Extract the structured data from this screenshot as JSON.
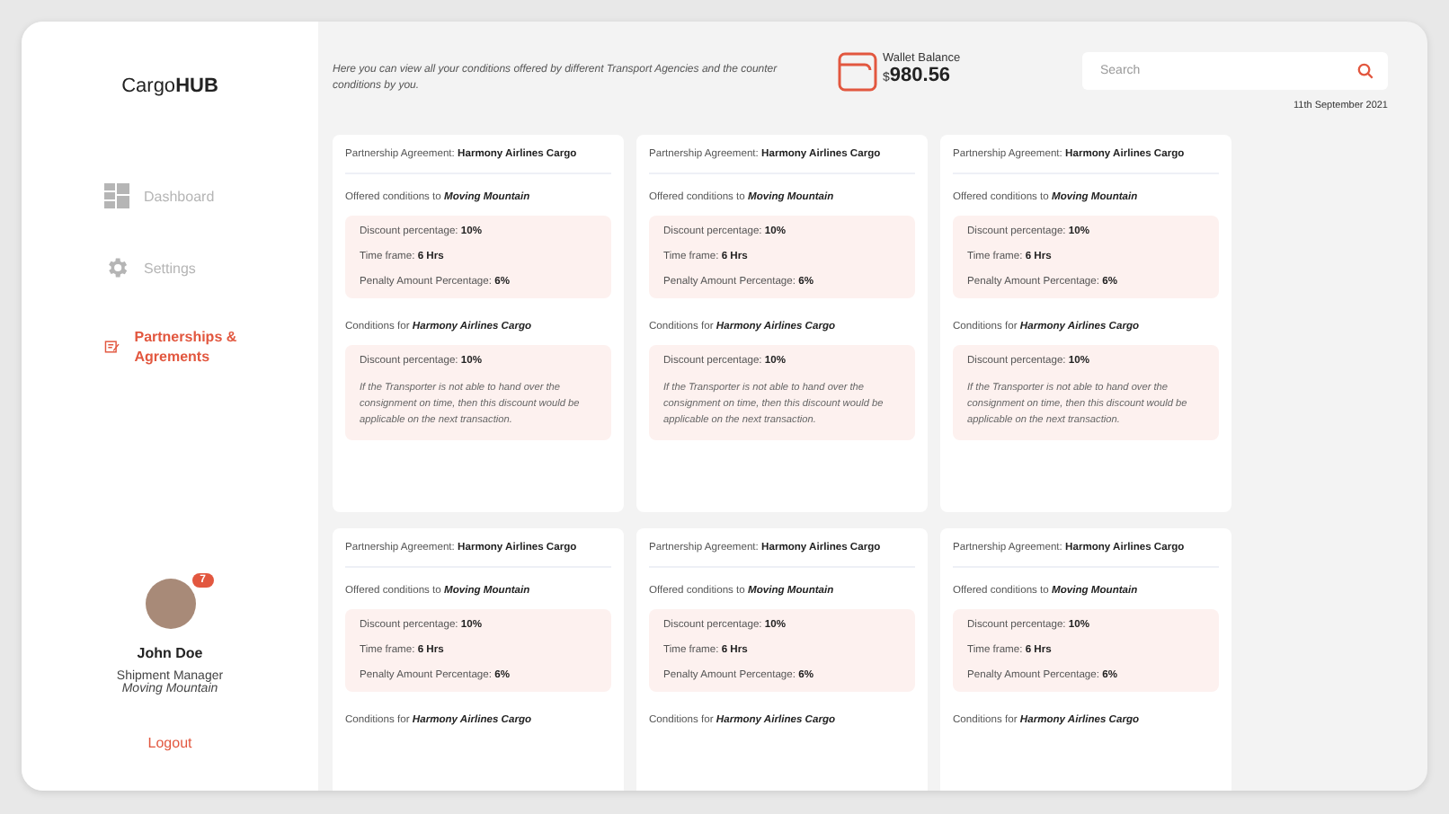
{
  "logo": {
    "light": "Cargo",
    "bold": "HUB"
  },
  "nav": [
    {
      "label": "Dashboard",
      "kind": "dashboard",
      "selected": false
    },
    {
      "label": "Settings",
      "kind": "settings",
      "selected": false
    },
    {
      "label": "Partnerships & Agrements",
      "kind": "partnerships",
      "selected": true
    }
  ],
  "user": {
    "name": "John Doe",
    "role": "Shipment Manager",
    "company": "Moving Mountain",
    "notifications": "7"
  },
  "logout": "Logout",
  "intro": "Here you can view all your conditions offered by different Transport Agencies and the counter conditions by you.",
  "wallet": {
    "label": "Wallet Balance",
    "currency": "$",
    "amount": "980.56"
  },
  "search": {
    "placeholder": "Search"
  },
  "date": "11th September 2021",
  "cards": [
    {
      "agreement_label": "Partnership Agreement:",
      "partner": "Harmony Airlines Cargo",
      "offered_label": "Offered conditions to",
      "offered_to": "Moving Mountain",
      "offered": [
        {
          "label": "Discount percentage:",
          "value": "10%"
        },
        {
          "label": "Time frame:",
          "value": "6 Hrs"
        },
        {
          "label": "Penalty Amount Percentage:",
          "value": "6%"
        }
      ],
      "counter_label": "Conditions for",
      "counter_party": "Harmony Airlines Cargo",
      "counter": [
        {
          "label": "Discount percentage:",
          "value": "10%"
        }
      ],
      "note": "If the Transporter is not able to hand over the consignment on time, then this discount would be applicable on the next transaction."
    },
    {
      "agreement_label": "Partnership Agreement:",
      "partner": "Harmony Airlines Cargo",
      "offered_label": "Offered conditions to",
      "offered_to": "Moving Mountain",
      "offered": [
        {
          "label": "Discount percentage:",
          "value": "10%"
        },
        {
          "label": "Time frame:",
          "value": "6 Hrs"
        },
        {
          "label": "Penalty Amount Percentage:",
          "value": "6%"
        }
      ],
      "counter_label": "Conditions for",
      "counter_party": "Harmony Airlines Cargo",
      "counter": [
        {
          "label": "Discount percentage:",
          "value": "10%"
        }
      ],
      "note": "If the Transporter is not able to hand over the consignment on time, then this discount would be applicable on the next transaction."
    },
    {
      "agreement_label": "Partnership Agreement:",
      "partner": "Harmony Airlines Cargo",
      "offered_label": "Offered conditions to",
      "offered_to": "Moving Mountain",
      "offered": [
        {
          "label": "Discount percentage:",
          "value": "10%"
        },
        {
          "label": "Time frame:",
          "value": "6 Hrs"
        },
        {
          "label": "Penalty Amount Percentage:",
          "value": "6%"
        }
      ],
      "counter_label": "Conditions for",
      "counter_party": "Harmony Airlines Cargo",
      "counter": [
        {
          "label": "Discount percentage:",
          "value": "10%"
        }
      ],
      "note": "If the Transporter is not able to hand over the consignment on time, then this discount would be applicable on the next transaction."
    },
    {
      "agreement_label": "Partnership Agreement:",
      "partner": "Harmony Airlines Cargo",
      "offered_label": "Offered conditions to",
      "offered_to": "Moving Mountain",
      "offered": [
        {
          "label": "Discount percentage:",
          "value": "10%"
        },
        {
          "label": "Time frame:",
          "value": "6 Hrs"
        },
        {
          "label": "Penalty Amount Percentage:",
          "value": "6%"
        }
      ],
      "counter_label": "Conditions for",
      "counter_party": "Harmony Airlines Cargo"
    },
    {
      "agreement_label": "Partnership Agreement:",
      "partner": "Harmony Airlines Cargo",
      "offered_label": "Offered conditions to",
      "offered_to": "Moving Mountain",
      "offered": [
        {
          "label": "Discount percentage:",
          "value": "10%"
        },
        {
          "label": "Time frame:",
          "value": "6 Hrs"
        },
        {
          "label": "Penalty Amount Percentage:",
          "value": "6%"
        }
      ],
      "counter_label": "Conditions for",
      "counter_party": "Harmony Airlines Cargo"
    },
    {
      "agreement_label": "Partnership Agreement:",
      "partner": "Harmony Airlines Cargo",
      "offered_label": "Offered conditions to",
      "offered_to": "Moving Mountain",
      "offered": [
        {
          "label": "Discount percentage:",
          "value": "10%"
        },
        {
          "label": "Time frame:",
          "value": "6 Hrs"
        },
        {
          "label": "Penalty Amount Percentage:",
          "value": "6%"
        }
      ],
      "counter_label": "Conditions for",
      "counter_party": "Harmony Airlines Cargo"
    }
  ]
}
